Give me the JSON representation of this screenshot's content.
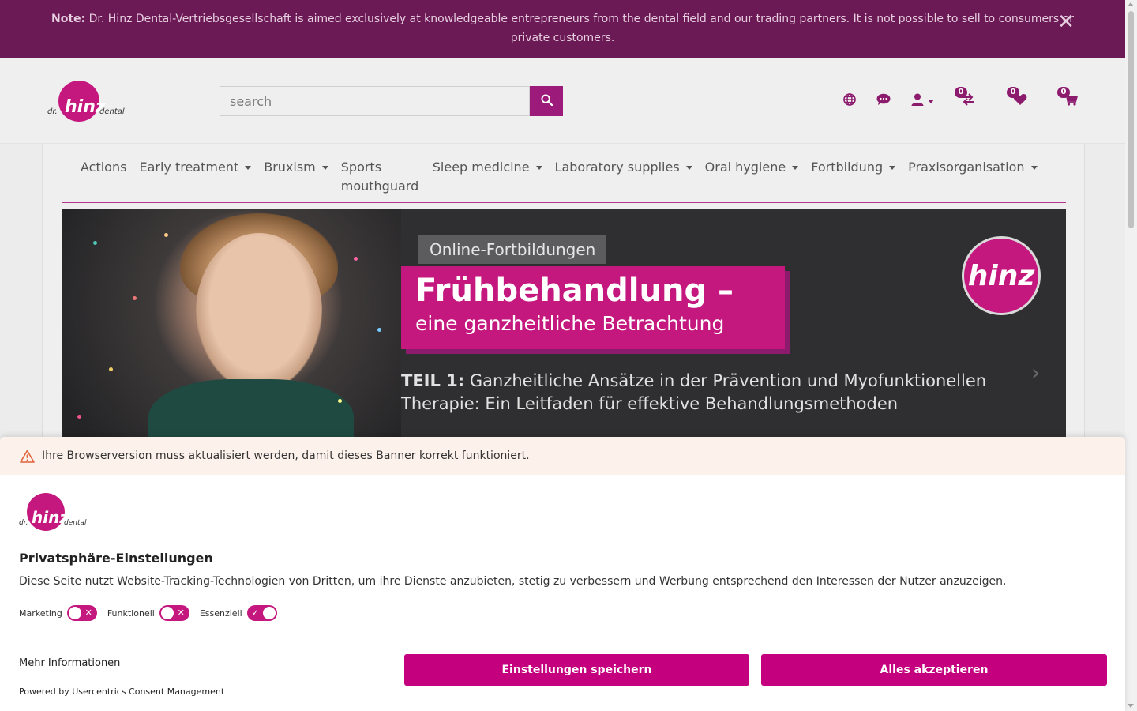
{
  "notice": {
    "label": "Note:",
    "text": "Dr. Hinz Dental-Vertriebsgesellschaft is aimed exclusively at knowledgeable entrepreneurs from the dental field and our trading partners. It is not possible to sell to consumers or private customers.",
    "close_glyph": "✕"
  },
  "header": {
    "logo": {
      "prefix": "dr.",
      "name": "hinz",
      "suffix": "dental"
    },
    "search": {
      "placeholder": "search"
    },
    "compare_count": "0",
    "wishlist_count": "0",
    "cart_count": "0"
  },
  "nav": {
    "items": [
      {
        "label": "Actions",
        "dropdown": false
      },
      {
        "label": "Early treatment",
        "dropdown": true
      },
      {
        "label": "Bruxism",
        "dropdown": true
      },
      {
        "label": "Sports mouthguard",
        "dropdown": false
      },
      {
        "label": "Sleep medicine",
        "dropdown": true
      },
      {
        "label": "Laboratory supplies",
        "dropdown": true
      },
      {
        "label": "Oral hygiene",
        "dropdown": true
      },
      {
        "label": "Fortbildung",
        "dropdown": true
      },
      {
        "label": "Praxisorganisation",
        "dropdown": true
      }
    ]
  },
  "banner": {
    "tag": "Online-Fortbildungen",
    "title_line1": "Frühbehandlung –",
    "title_line2": "eine ganzheitliche Betrachtung",
    "part1_label": "TEIL 1:",
    "part1_text": "Ganzheitliche Ansätze in der Prävention und Myofunktionellen Therapie: Ein Leitfaden für effektive Behandlungsmethoden",
    "logo_text": "hinz"
  },
  "consent": {
    "warning": "Ihre Browserversion muss aktualisiert werden, damit dieses Banner korrekt funktioniert.",
    "title": "Privatsphäre-Einstellungen",
    "description": "Diese Seite nutzt Website-Tracking-Technologien von Dritten, um ihre Dienste anzubieten, stetig zu verbessern und Werbung entsprechend den Interessen der Nutzer anzuzeigen.",
    "toggles": [
      {
        "label": "Marketing",
        "on": false
      },
      {
        "label": "Funktionell",
        "on": false
      },
      {
        "label": "Essenziell",
        "on": true
      }
    ],
    "more_info": "Mehr Informationen",
    "save_label": "Einstellungen speichern",
    "accept_label": "Alles akzeptieren",
    "powered_by": "Powered by Usercentrics Consent Management"
  },
  "colors": {
    "brand": "#c4187f",
    "notice_bg": "#6b1a55",
    "icon": "#8c1a6d"
  },
  "icons": [
    "close-icon",
    "search-icon",
    "globe-icon",
    "chat-icon",
    "user-icon",
    "compare-icon",
    "heart-icon",
    "cart-icon",
    "warning-icon",
    "chevron-right-icon"
  ]
}
